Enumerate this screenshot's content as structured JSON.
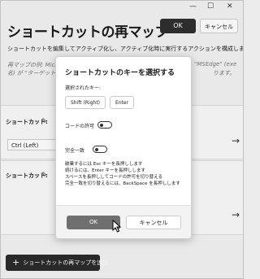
{
  "window": {
    "title": "ショートカットの再マップ",
    "ok_label": "OK",
    "cancel_label": "キャンセル",
    "controls": {
      "minimize": "—",
      "maximize": "☐",
      "close": "✕"
    }
  },
  "description": {
    "line1": "ショートカットを編集してアクティブ化し、アクティブ化時に実行するアクションを構成します。",
    "line2": "再マップの例: Microsoft",
    "line2b": "\"MSEdge\" (exe",
    "line3": "名) が \"ターゲット アプ",
    "line3b": "ります。"
  },
  "rows": [
    {
      "label": "ショートカット:",
      "select_value": "Ctrl (Left)"
    },
    {
      "label": "ショートカット:"
    }
  ],
  "add_button": {
    "icon": "plus-icon",
    "label": "ショートカットの再マップを追加"
  },
  "dialog": {
    "title": "ショートカットのキーを選択する",
    "selected_label": "選択されたキー:",
    "keys": [
      "Shift (Right)",
      "Enter"
    ],
    "toggles": [
      {
        "label": "コードの許可",
        "on": false
      },
      {
        "label": "完全一致",
        "on": false
      }
    ],
    "instructions": [
      "破棄するには Esc キーを長押しします",
      "続けるには、Enter キーを長押しします",
      "スペースを長押ししてコードの許可を切り替える",
      "完全一致を切り替えるには、BackSpace を長押しします"
    ],
    "ok_label": "OK",
    "cancel_label": "キャンセル"
  }
}
